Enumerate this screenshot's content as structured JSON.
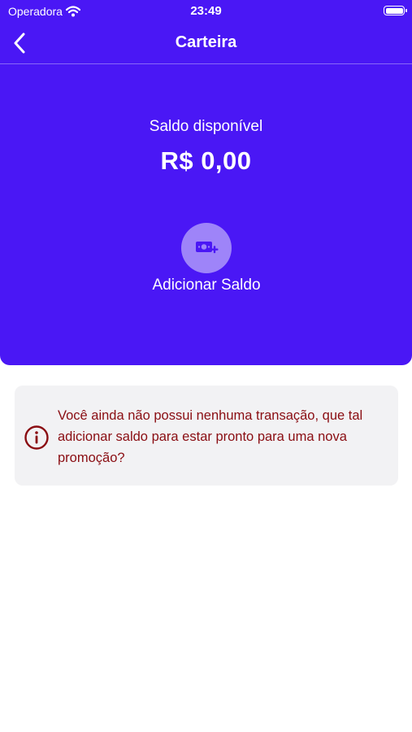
{
  "status_bar": {
    "carrier": "Operadora",
    "time": "23:49"
  },
  "header": {
    "title": "Carteira"
  },
  "balance": {
    "label": "Saldo disponível",
    "value": "R$ 0,00"
  },
  "actions": {
    "add_balance_label": "Adicionar Saldo"
  },
  "notice": {
    "message": "Você ainda não possui nenhuma transação, que tal adicionar saldo para estar pronto para uma nova promoção?"
  },
  "colors": {
    "primary": "#4a17f5",
    "button_circle": "#9e84f9",
    "notice_text": "#8a0d12",
    "notice_bg": "#f2f2f4"
  },
  "icons": {
    "back": "chevron-left-icon",
    "add_balance": "money-add-icon",
    "info": "info-circle-icon",
    "wifi": "wifi-icon",
    "battery": "battery-icon"
  }
}
